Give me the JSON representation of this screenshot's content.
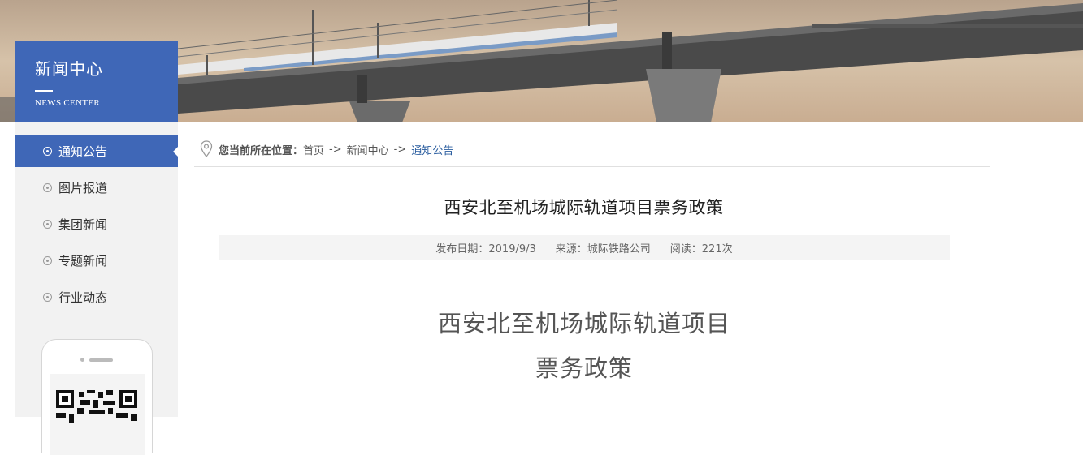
{
  "sidebar": {
    "title_zh": "新闻中心",
    "title_en": "NEWS CENTER",
    "items": [
      {
        "label": "通知公告",
        "active": true
      },
      {
        "label": "图片报道"
      },
      {
        "label": "集团新闻"
      },
      {
        "label": "专题新闻"
      },
      {
        "label": "行业动态"
      }
    ]
  },
  "breadcrumb": {
    "label": "您当前所在位置：",
    "home": "首页",
    "sep1": "->",
    "section": "新闻中心",
    "sep2": "->",
    "current": "通知公告"
  },
  "article": {
    "title": "西安北至机场城际轨道项目票务政策",
    "date": "发布日期：2019/9/3",
    "source": "来源：城际铁路公司",
    "views": "阅读：221次",
    "body_line1": "西安北至机场城际轨道项目",
    "body_line2": "票务政策"
  },
  "colors": {
    "accent": "#3f67b7",
    "link": "#2a5d9f",
    "sidebar_bg": "#f2f2f2"
  },
  "icons": {
    "location": "location-pin-icon",
    "qr": "qr-code-icon"
  }
}
